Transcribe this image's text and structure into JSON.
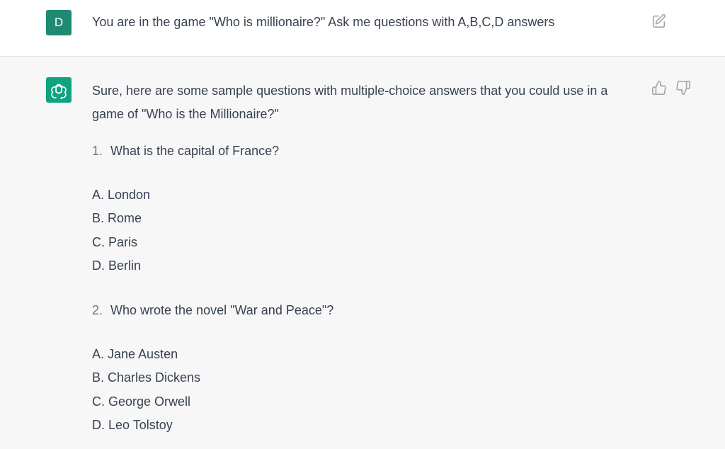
{
  "user_message": {
    "avatar_letter": "D",
    "text": "You are in the game \"Who is millionaire?\" Ask me questions with A,B,C,D answers"
  },
  "assistant_message": {
    "intro": "Sure, here are some sample questions with multiple-choice answers that you could use in a game of \"Who is the Millionaire?\"",
    "questions": [
      {
        "number": "1.",
        "text": "What is the capital of France?",
        "answers": [
          "A. London",
          "B. Rome",
          "C. Paris",
          "D. Berlin"
        ]
      },
      {
        "number": "2.",
        "text": "Who wrote the novel \"War and Peace\"?",
        "answers": [
          "A. Jane Austen",
          "B. Charles Dickens",
          "C. George Orwell",
          "D. Leo Tolstoy"
        ]
      }
    ]
  },
  "icons": {
    "edit": "edit-icon",
    "thumbs_up": "thumbs-up-icon",
    "thumbs_down": "thumbs-down-icon",
    "assistant_logo": "openai-logo-icon"
  },
  "colors": {
    "user_avatar": "#1f8a72",
    "assistant_avatar": "#10a37f",
    "assistant_background": "#f7f7f8",
    "user_background": "#ffffff"
  }
}
